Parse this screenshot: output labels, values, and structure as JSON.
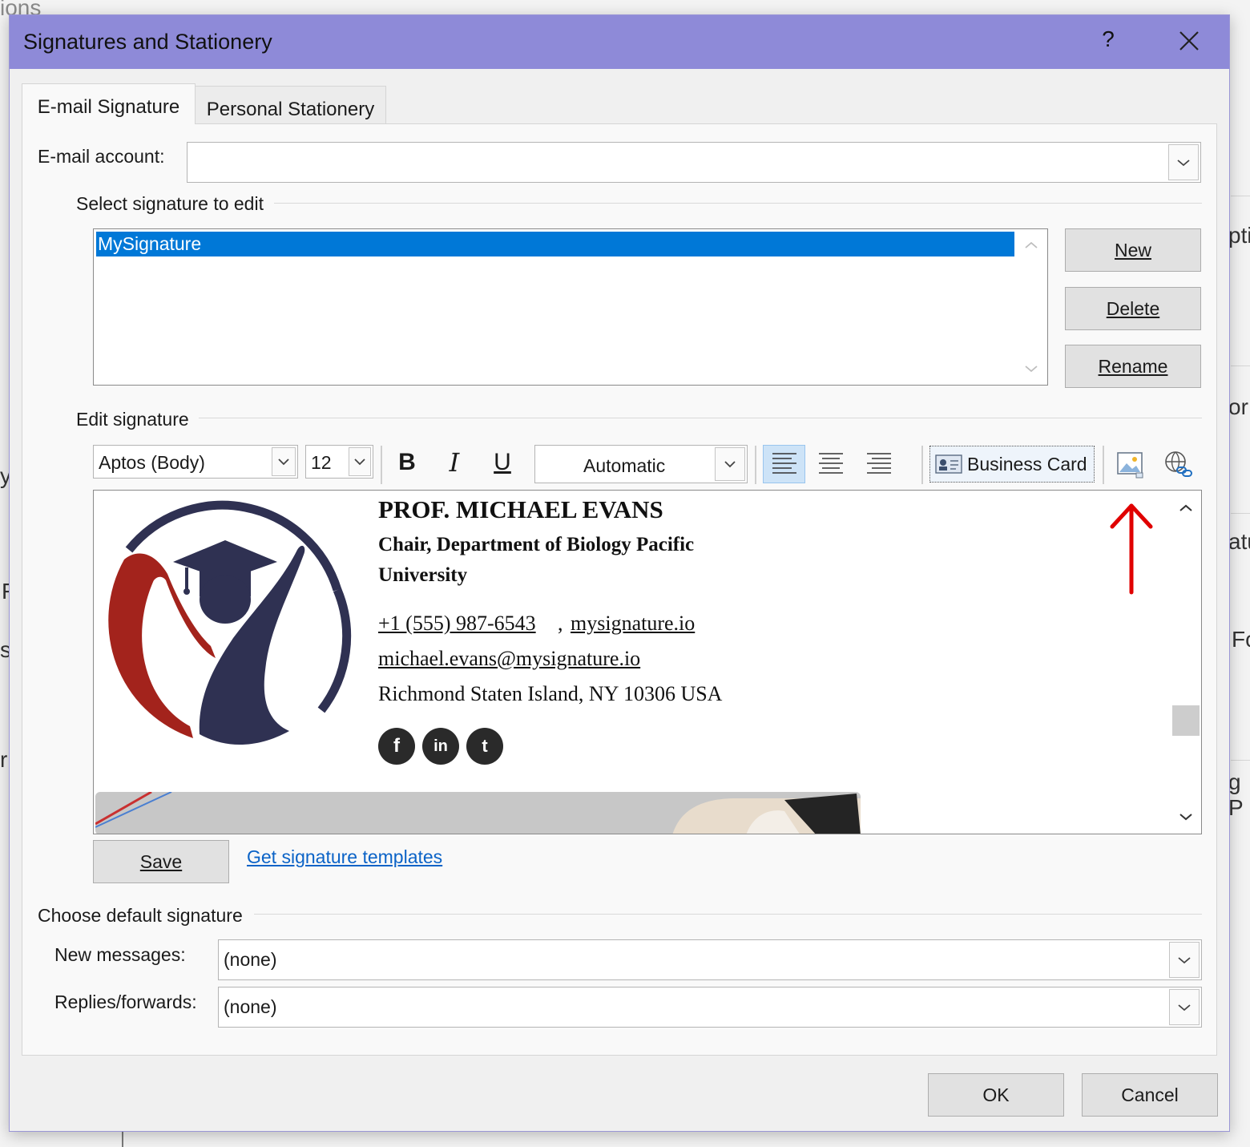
{
  "background": {
    "fragments": [
      "ions",
      "pti",
      "or",
      "atu",
      "Fo",
      "g P",
      "y",
      "F",
      "s",
      "r"
    ]
  },
  "dialog": {
    "title": "Signatures and Stationery",
    "help_label": "?",
    "tabs": {
      "email_signature": "E-mail Signature",
      "personal_stationery": "Personal Stationery"
    },
    "email_account": {
      "label": "E-mail account:",
      "value": ""
    },
    "select_signature": {
      "heading": "Select signature to edit",
      "items": [
        "MySignature"
      ],
      "selected": "MySignature"
    },
    "buttons": {
      "new": "New",
      "delete": "Delete",
      "rename": "Rename",
      "save": "Save",
      "ok": "OK",
      "cancel": "Cancel"
    },
    "edit_signature": {
      "heading": "Edit signature",
      "font": "Aptos (Body)",
      "size": "12",
      "color": "Automatic",
      "business_card": "Business Card",
      "bold": "B",
      "italic": "I",
      "underline": "U"
    },
    "signature": {
      "name": "PROF. MICHAEL EVANS",
      "title_line1": "Chair, Department of Biology Pacific",
      "title_line2": "University",
      "phone": "+1 (555) 987-6543",
      "separator": ",",
      "website": "mysignature.io",
      "email": "michael.evans@mysignature.io",
      "address": "Richmond Staten Island, NY 10306 USA",
      "social": [
        {
          "icon": "facebook-icon",
          "glyph": "f"
        },
        {
          "icon": "linkedin-icon",
          "glyph": "in"
        },
        {
          "icon": "twitter-icon",
          "glyph": "t"
        }
      ],
      "logo_colors": {
        "navy": "#2f3152",
        "red": "#a3231c"
      }
    },
    "templates_link": "Get signature templates",
    "default_signature": {
      "heading": "Choose default signature",
      "new_messages_label": "New messages:",
      "new_messages_value": "(none)",
      "replies_label": "Replies/forwards:",
      "replies_value": "(none)"
    },
    "colors": {
      "titlebar": "#8e8ad8",
      "selection": "#0078d7",
      "link": "#0b63c7",
      "annotation_arrow": "#e00000"
    }
  }
}
